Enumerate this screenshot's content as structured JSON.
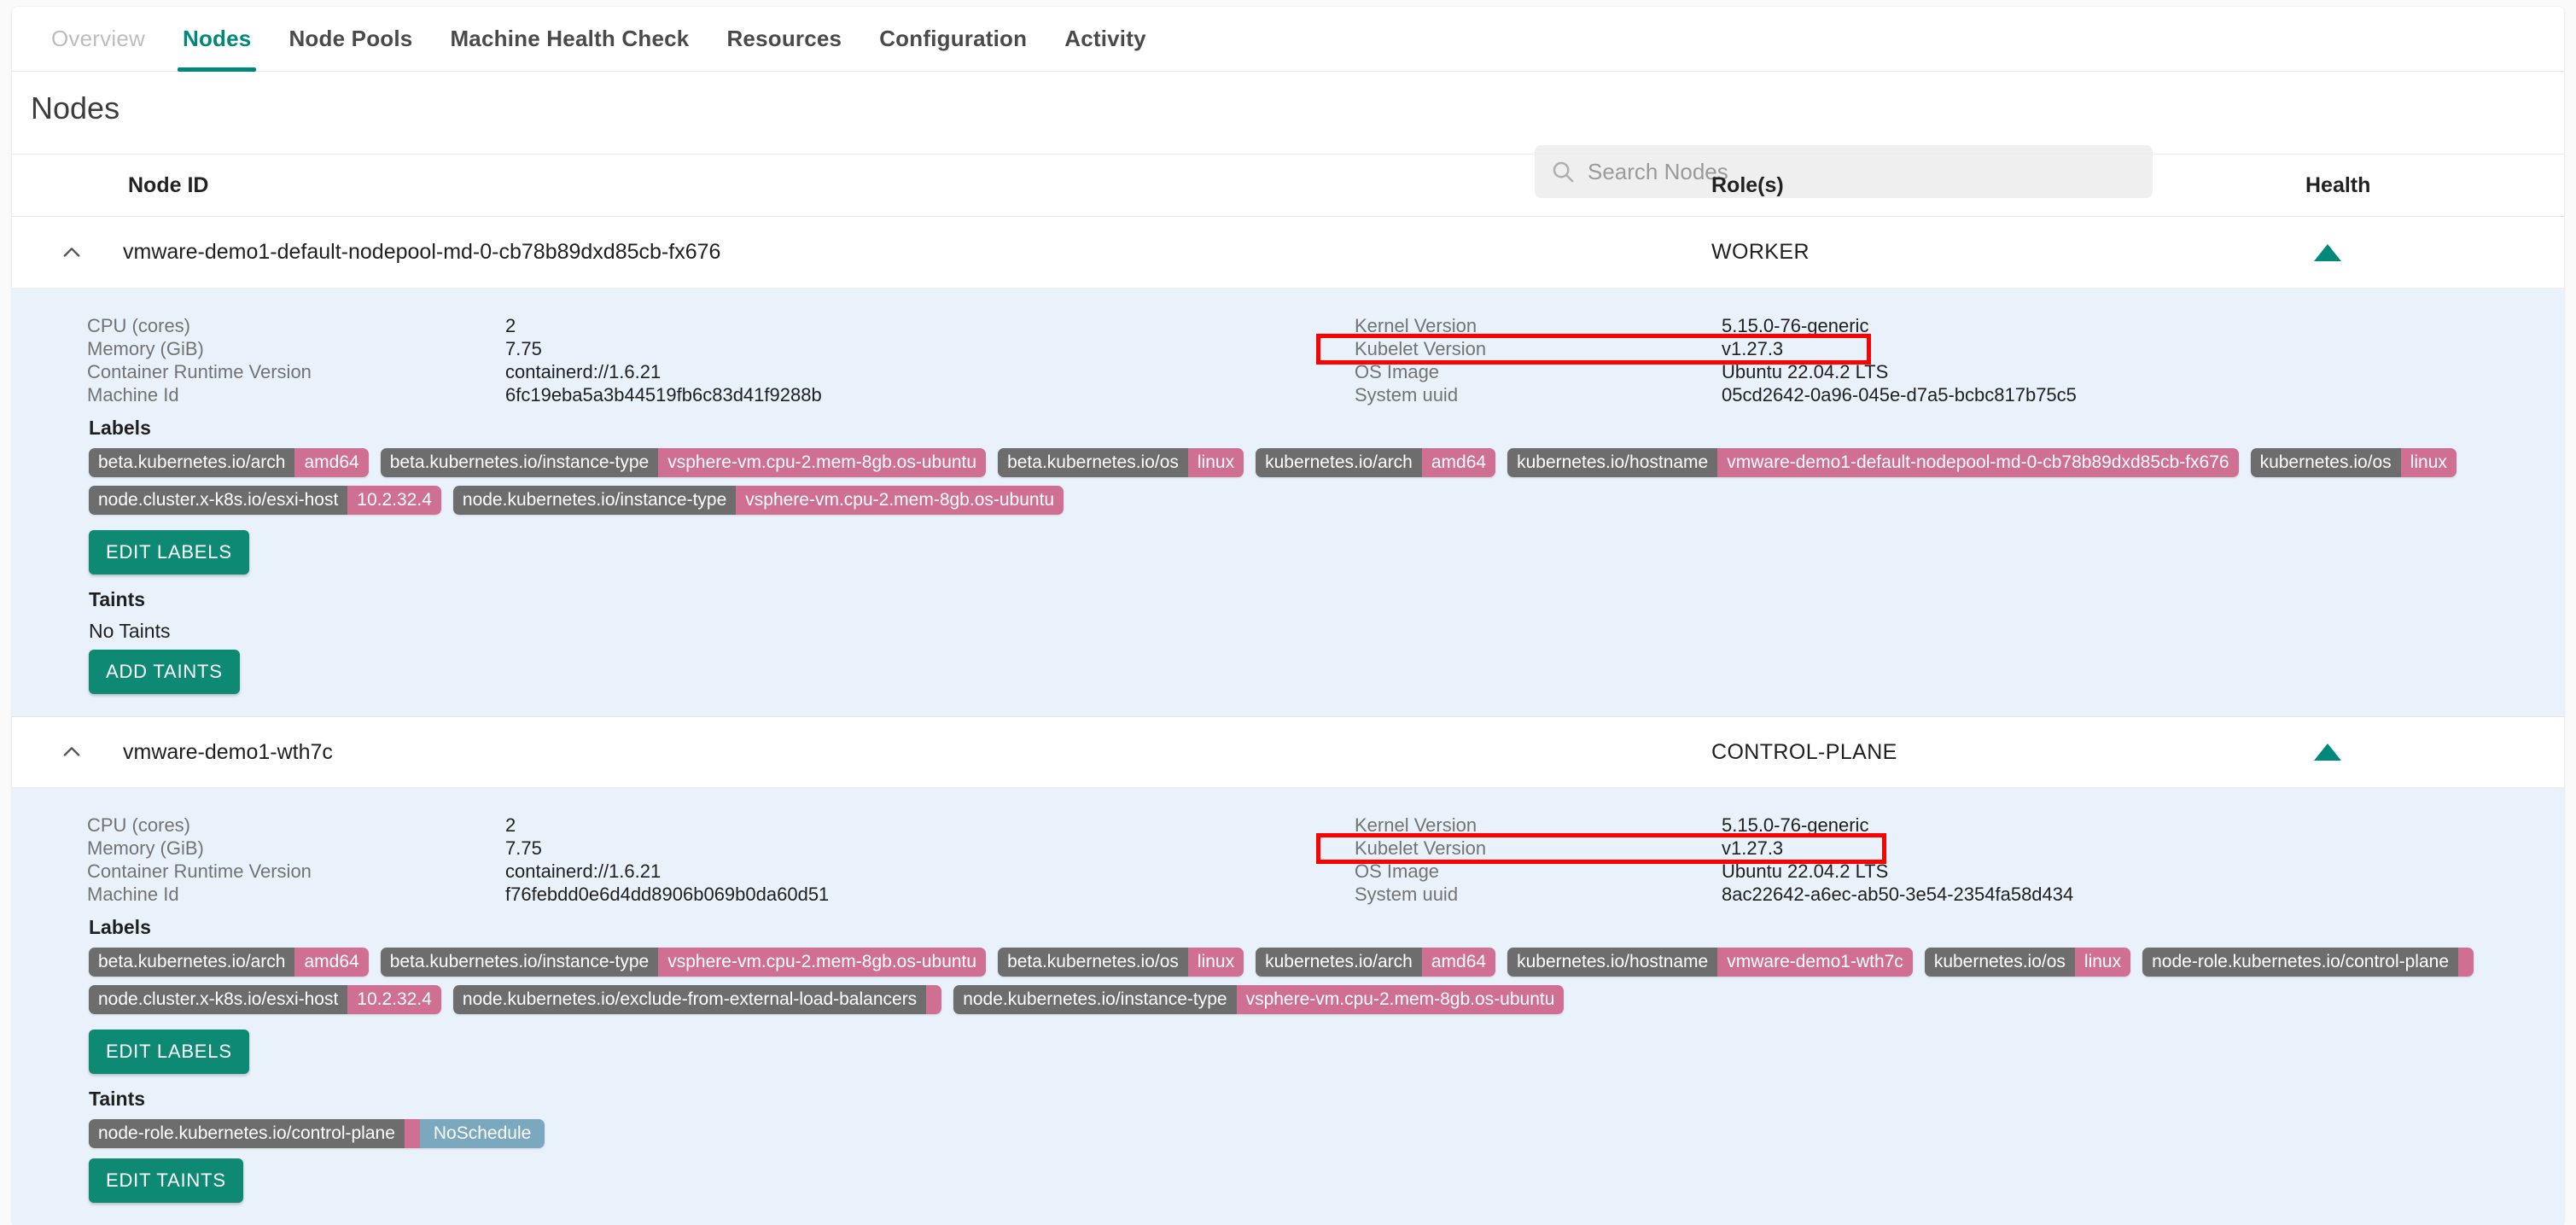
{
  "tabs": [
    {
      "label": "Overview",
      "state": "dim"
    },
    {
      "label": "Nodes",
      "state": "active"
    },
    {
      "label": "Node Pools",
      "state": "strong"
    },
    {
      "label": "Machine Health Check",
      "state": "strong"
    },
    {
      "label": "Resources",
      "state": "strong"
    },
    {
      "label": "Configuration",
      "state": "strong"
    },
    {
      "label": "Activity",
      "state": "strong"
    }
  ],
  "page": {
    "title": "Nodes"
  },
  "search": {
    "placeholder": "Search Nodes",
    "value": "",
    "icon": "search-icon"
  },
  "table": {
    "headers": {
      "node_id": "Node ID",
      "roles": "Role(s)",
      "health": "Health"
    }
  },
  "labels_heading": "Labels",
  "taints_heading": "Taints",
  "buttons": {
    "edit_labels": "EDIT LABELS",
    "add_taints": "ADD TAINTS",
    "edit_taints": "EDIT TAINTS"
  },
  "no_taints_text": "No Taints",
  "colors": {
    "accent": "#00897b",
    "button": "#0e8a74",
    "detail_bg": "#e9f2fb",
    "chip_key": "#6d6d6d",
    "chip_value": "#cf7093",
    "chip_effect": "#7aa8bf",
    "highlight": "#ff0000",
    "health_ok": "#00897b"
  },
  "spec_keys": {
    "cpu": "CPU (cores)",
    "memory": "Memory (GiB)",
    "runtime": "Container Runtime Version",
    "machine_id": "Machine Id",
    "kernel": "Kernel Version",
    "kubelet": "Kubelet Version",
    "os_image": "OS Image",
    "system_uuid": "System uuid"
  },
  "nodes": [
    {
      "id": "vmware-demo1-default-nodepool-md-0-cb78b89dxd85cb-fx676",
      "role": "WORKER",
      "health": "healthy",
      "expanded": true,
      "specs": {
        "cpu": "2",
        "memory": "7.75",
        "runtime": "containerd://1.6.21",
        "machine_id": "6fc19eba5a3b44519fb6c83d41f9288b",
        "kernel": "5.15.0-76-generic",
        "kubelet": "v1.27.3",
        "os_image": "Ubuntu 22.04.2 LTS",
        "system_uuid": "05cd2642-0a96-045e-d7a5-bcbc817b75c5"
      },
      "labels": [
        {
          "key": "beta.kubernetes.io/arch",
          "value": "amd64"
        },
        {
          "key": "beta.kubernetes.io/instance-type",
          "value": "vsphere-vm.cpu-2.mem-8gb.os-ubuntu"
        },
        {
          "key": "beta.kubernetes.io/os",
          "value": "linux"
        },
        {
          "key": "kubernetes.io/arch",
          "value": "amd64"
        },
        {
          "key": "kubernetes.io/hostname",
          "value": "vmware-demo1-default-nodepool-md-0-cb78b89dxd85cb-fx676"
        },
        {
          "key": "kubernetes.io/os",
          "value": "linux"
        },
        {
          "key": "node.cluster.x-k8s.io/esxi-host",
          "value": "10.2.32.4"
        },
        {
          "key": "node.kubernetes.io/instance-type",
          "value": "vsphere-vm.cpu-2.mem-8gb.os-ubuntu"
        }
      ],
      "taints": []
    },
    {
      "id": "vmware-demo1-wth7c",
      "role": "CONTROL-PLANE",
      "health": "healthy",
      "expanded": true,
      "specs": {
        "cpu": "2",
        "memory": "7.75",
        "runtime": "containerd://1.6.21",
        "machine_id": "f76febdd0e6d4dd8906b069b0da60d51",
        "kernel": "5.15.0-76-generic",
        "kubelet": "v1.27.3",
        "os_image": "Ubuntu 22.04.2 LTS",
        "system_uuid": "8ac22642-a6ec-ab50-3e54-2354fa58d434"
      },
      "labels": [
        {
          "key": "beta.kubernetes.io/arch",
          "value": "amd64"
        },
        {
          "key": "beta.kubernetes.io/instance-type",
          "value": "vsphere-vm.cpu-2.mem-8gb.os-ubuntu"
        },
        {
          "key": "beta.kubernetes.io/os",
          "value": "linux"
        },
        {
          "key": "kubernetes.io/arch",
          "value": "amd64"
        },
        {
          "key": "kubernetes.io/hostname",
          "value": "vmware-demo1-wth7c"
        },
        {
          "key": "kubernetes.io/os",
          "value": "linux"
        },
        {
          "key": "node-role.kubernetes.io/control-plane",
          "value": ""
        },
        {
          "key": "node.cluster.x-k8s.io/esxi-host",
          "value": "10.2.32.4"
        },
        {
          "key": "node.kubernetes.io/exclude-from-external-load-balancers",
          "value": ""
        },
        {
          "key": "node.kubernetes.io/instance-type",
          "value": "vsphere-vm.cpu-2.mem-8gb.os-ubuntu"
        }
      ],
      "taints": [
        {
          "key": "node-role.kubernetes.io/control-plane",
          "value": "",
          "effect": "NoSchedule"
        }
      ]
    }
  ]
}
